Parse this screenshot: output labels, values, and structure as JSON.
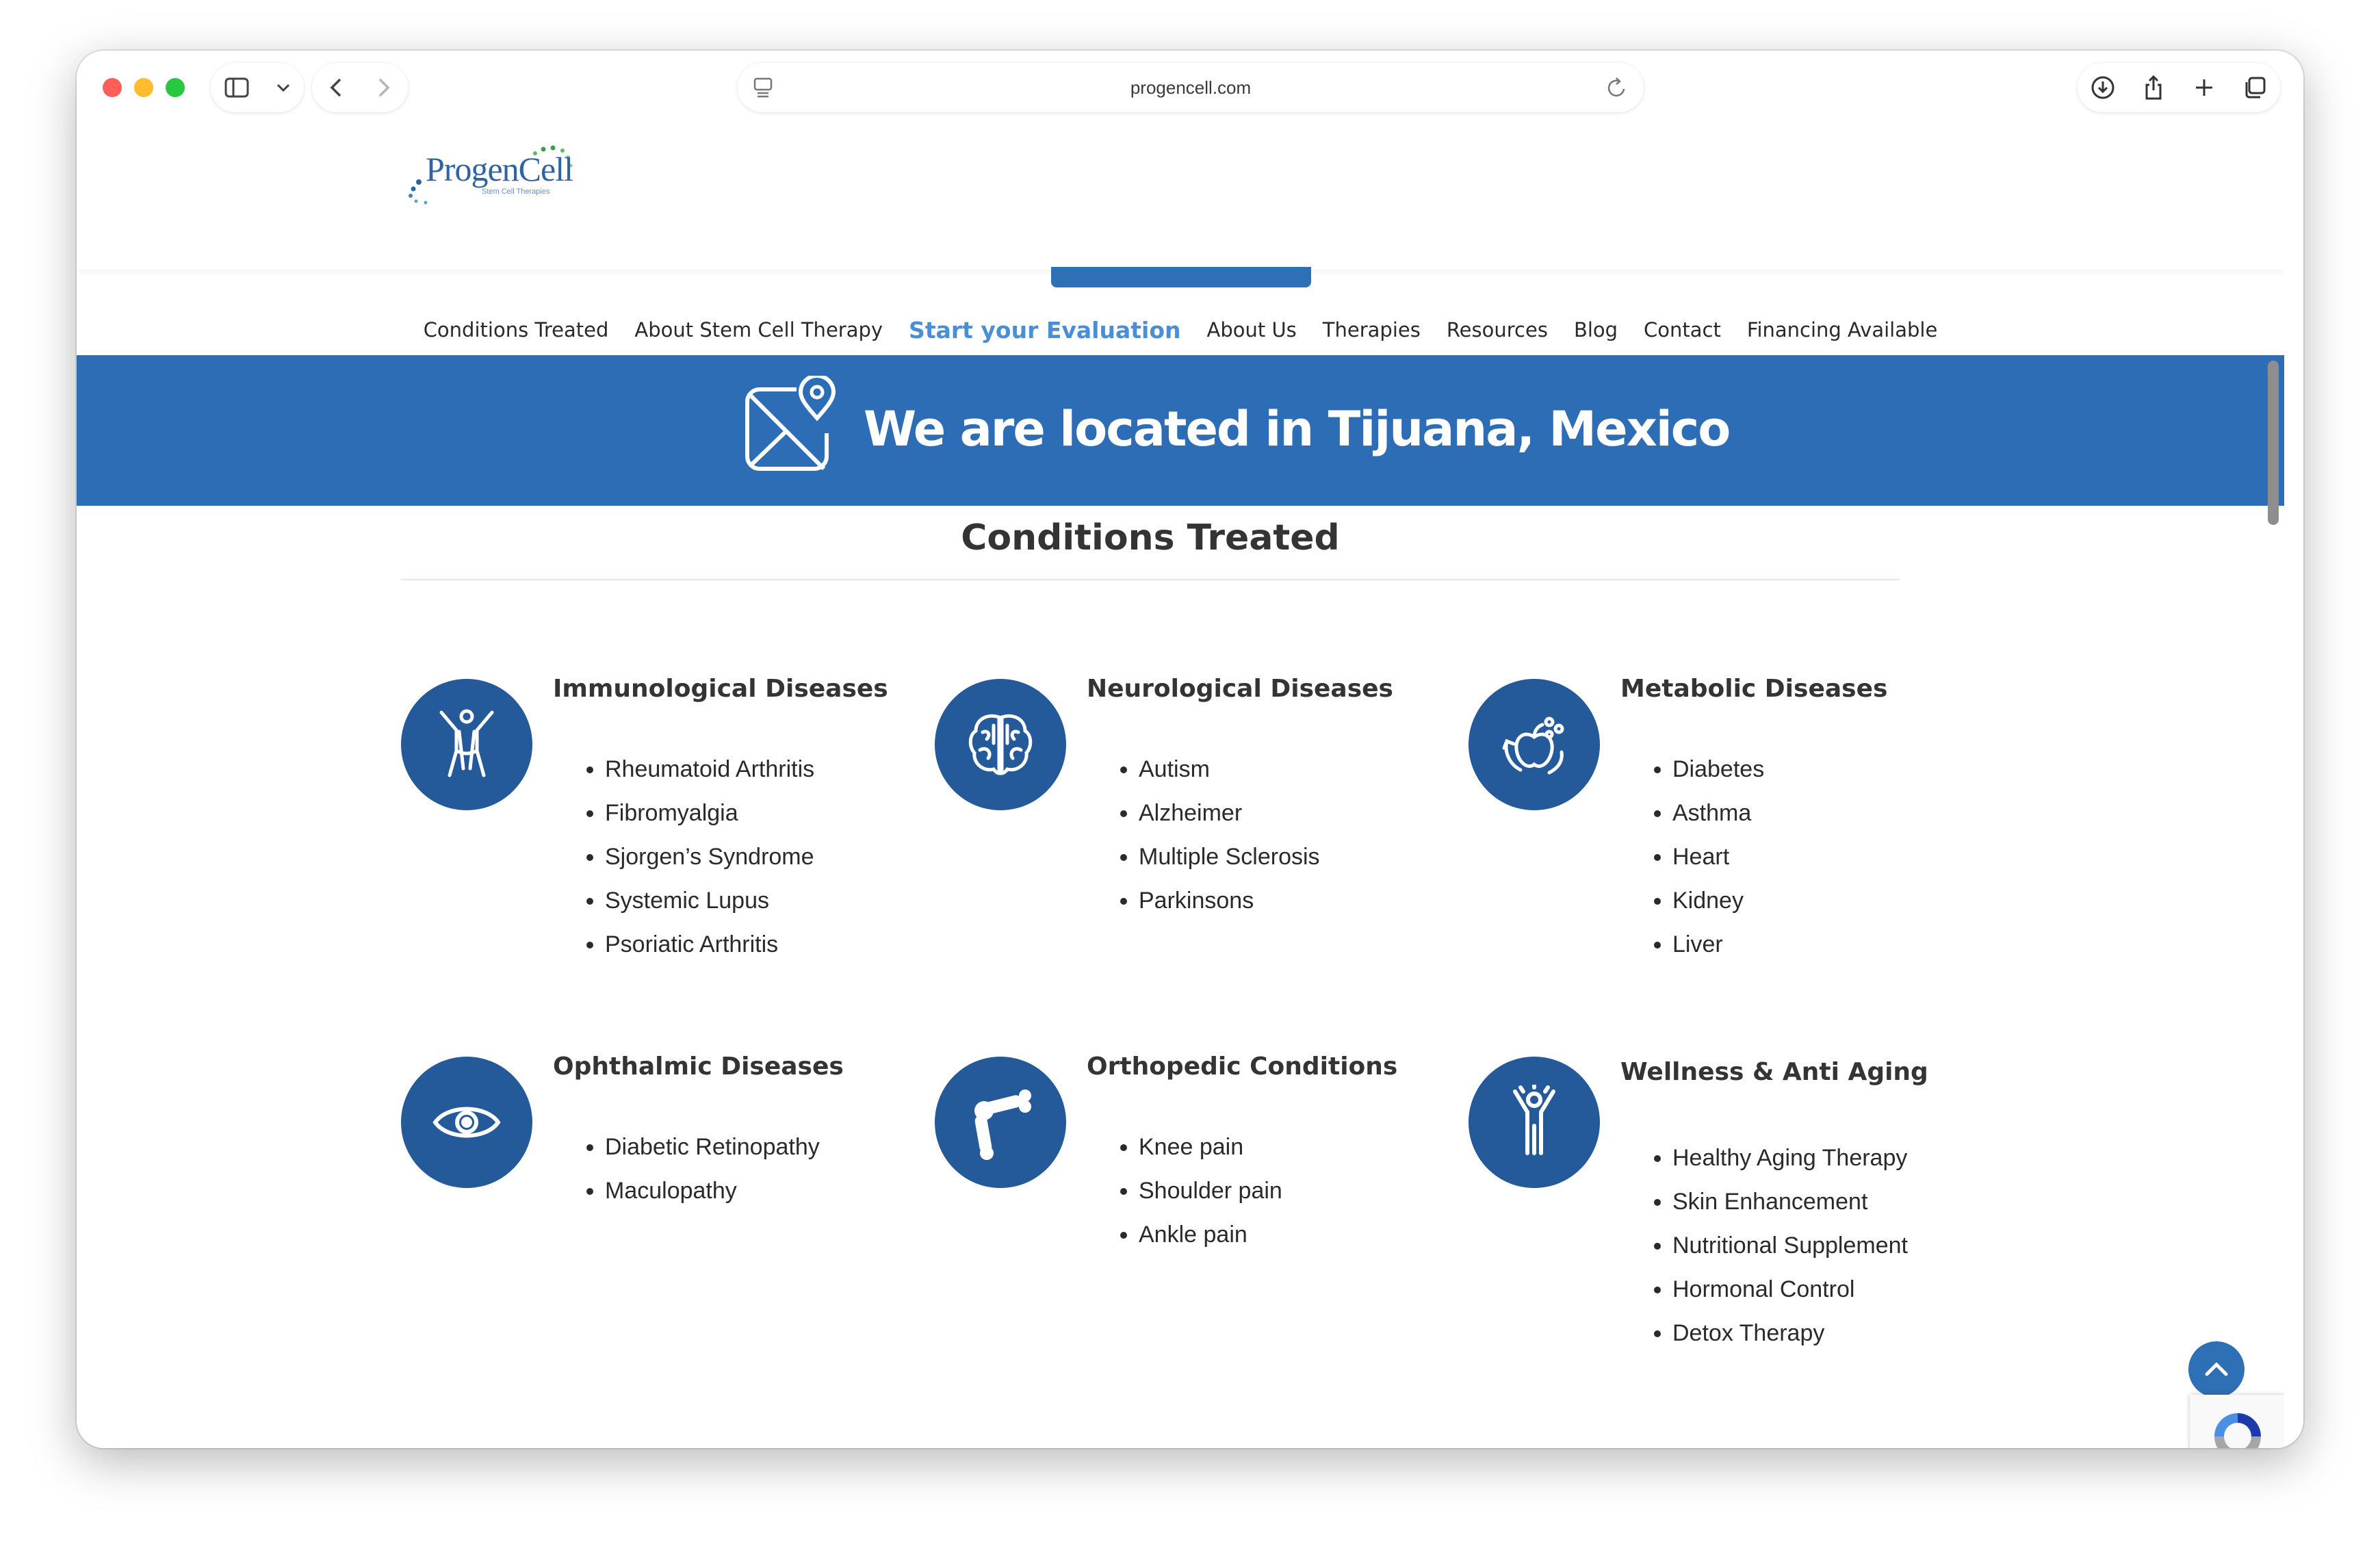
{
  "browser": {
    "url": "progencell.com"
  },
  "logo": {
    "name": "ProgenCell",
    "tagline": "Stem Cell Therapies"
  },
  "nav": {
    "items": [
      "Conditions Treated",
      "About Stem Cell Therapy",
      "Start your Evaluation",
      "About Us",
      "Therapies",
      "Resources",
      "Blog",
      "Contact",
      "Financing Available"
    ],
    "active_index": 2
  },
  "banner": {
    "text": "We are located in Tijuana, Mexico"
  },
  "section": {
    "title": "Conditions Treated"
  },
  "conditions": [
    {
      "title": "Immunological Diseases",
      "icon": "person-arms-up-icon",
      "items": [
        "Rheumatoid Arthritis",
        "Fibromyalgia",
        "Sjorgen’s Syndrome",
        "Systemic Lupus",
        "Psoriatic Arthritis"
      ]
    },
    {
      "title": "Neurological Diseases",
      "icon": "brain-icon",
      "items": [
        "Autism",
        "Alzheimer",
        "Multiple Sclerosis",
        "Parkinsons"
      ]
    },
    {
      "title": "Metabolic Diseases",
      "icon": "apple-cycle-icon",
      "items": [
        "Diabetes",
        "Asthma",
        "Heart",
        "Kidney",
        "Liver"
      ]
    },
    {
      "title": "Ophthalmic Diseases",
      "icon": "eye-icon",
      "items": [
        "Diabetic Retinopathy",
        "Maculopathy"
      ]
    },
    {
      "title": "Orthopedic Conditions",
      "icon": "bone-joint-icon",
      "items": [
        "Knee pain",
        "Shoulder pain",
        "Ankle pain"
      ]
    },
    {
      "title": "Wellness & Anti Aging",
      "icon": "person-wellness-icon",
      "items": [
        "Healthy Aging Therapy",
        "Skin Enhancement",
        "Nutritional Supplement",
        "Hormonal Control",
        "Detox Therapy"
      ]
    }
  ],
  "colors": {
    "brand_blue": "#2d6db5",
    "icon_circle": "#24599a",
    "nav_active": "#4a8fd6"
  }
}
